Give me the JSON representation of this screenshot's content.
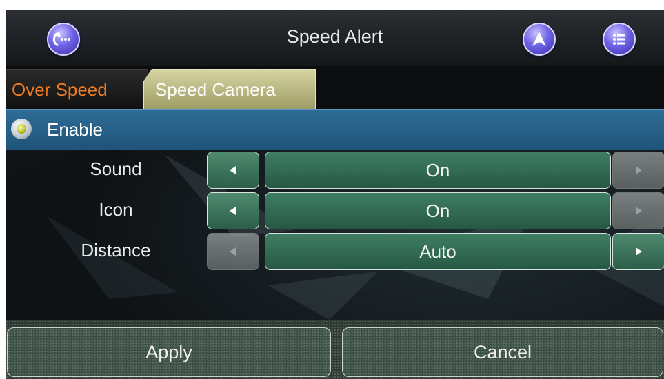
{
  "header": {
    "title": "Speed Alert",
    "back_icon": "back-ellipsis-icon",
    "navigate_icon": "navigation-arrow-icon",
    "menu_icon": "list-menu-icon"
  },
  "tabs": [
    {
      "label": "Over Speed",
      "active": false
    },
    {
      "label": "Speed Camera",
      "active": true
    }
  ],
  "enable": {
    "label": "Enable",
    "checked": true
  },
  "settings": [
    {
      "label": "Sound",
      "value": "On",
      "left_enabled": true,
      "right_enabled": false
    },
    {
      "label": "Icon",
      "value": "On",
      "left_enabled": true,
      "right_enabled": false
    },
    {
      "label": "Distance",
      "value": "Auto",
      "left_enabled": false,
      "right_enabled": true
    }
  ],
  "buttons": {
    "apply": "Apply",
    "cancel": "Cancel"
  },
  "colors": {
    "tab_inactive_text": "#ef7b22",
    "tab_active_bg": "#c2c08a",
    "enable_row": "#2a6790",
    "control_green": "#3a7a5f",
    "round_button": "#6f63e6"
  }
}
